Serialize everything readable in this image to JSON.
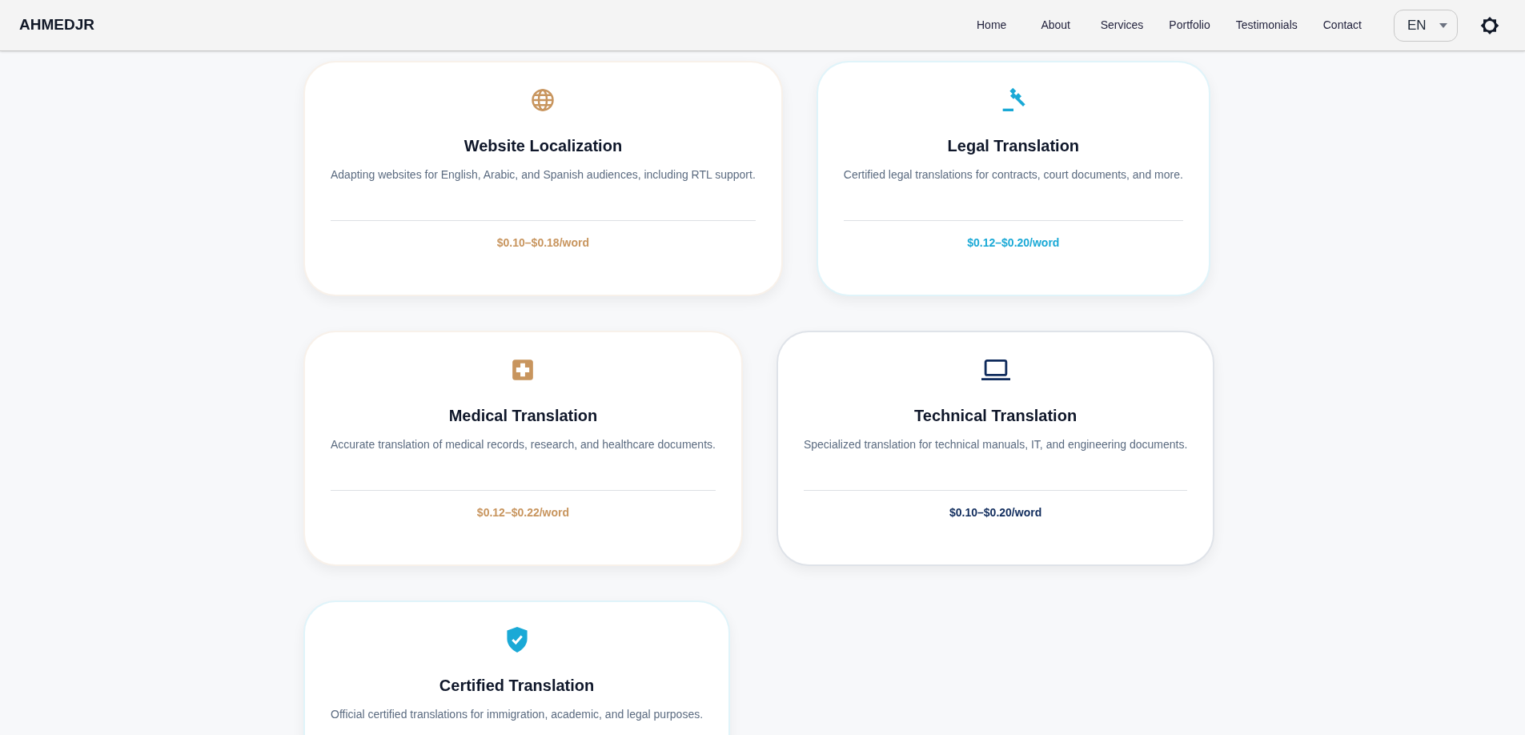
{
  "navbar": {
    "logo": "AHMEDJR",
    "links": [
      "Home",
      "About",
      "Services",
      "Portfolio",
      "Testimonials",
      "Contact"
    ],
    "language": "EN"
  },
  "services": [
    {
      "kind": "globe",
      "color": "#c8955e",
      "title": "Website Localization",
      "description": "Adapting websites for English, Arabic, and Spanish audiences, including RTL support.",
      "price": "$0.10–$0.18/word"
    },
    {
      "kind": "gavel",
      "color": "#1aa9d6",
      "title": "Legal Translation",
      "description": "Certified legal translations for contracts, court documents, and more.",
      "price": "$0.12–$0.20/word"
    },
    {
      "kind": "medical",
      "color": "#c8955e",
      "title": "Medical Translation",
      "description": "Accurate translation of medical records, research, and healthcare documents.",
      "price": "$0.12–$0.22/word"
    },
    {
      "kind": "laptop",
      "color": "#0f2b5c",
      "title": "Technical Translation",
      "description": "Specialized translation for technical manuals, IT, and engineering documents.",
      "price": "$0.10–$0.20/word"
    },
    {
      "kind": "shield",
      "color": "#1aa9d6",
      "title": "Certified Translation",
      "description": "Official certified translations for immigration, academic, and legal purposes."
    }
  ]
}
